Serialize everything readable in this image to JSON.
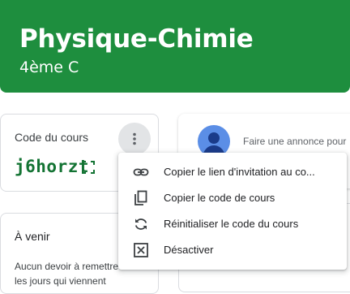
{
  "banner": {
    "title": "Physique-Chimie",
    "subtitle": "4ème C",
    "color": "#1e8e3e"
  },
  "code_card": {
    "label": "Code du cours",
    "code": "j6horzt",
    "more_icon": "more-vert-icon",
    "expand_icon": "fullscreen-icon"
  },
  "upcoming": {
    "title": "À venir",
    "text": "Aucun devoir à remettre dans les jours qui viennent"
  },
  "announce": {
    "placeholder": "Faire une annonce pour"
  },
  "menu": {
    "items": [
      {
        "label": "Copier le lien d'invitation au co...",
        "icon": "link-icon"
      },
      {
        "label": "Copier le code de cours",
        "icon": "copy-icon"
      },
      {
        "label": "Réinitialiser le code du cours",
        "icon": "reset-icon"
      },
      {
        "label": "Désactiver",
        "icon": "disable-icon"
      }
    ]
  }
}
